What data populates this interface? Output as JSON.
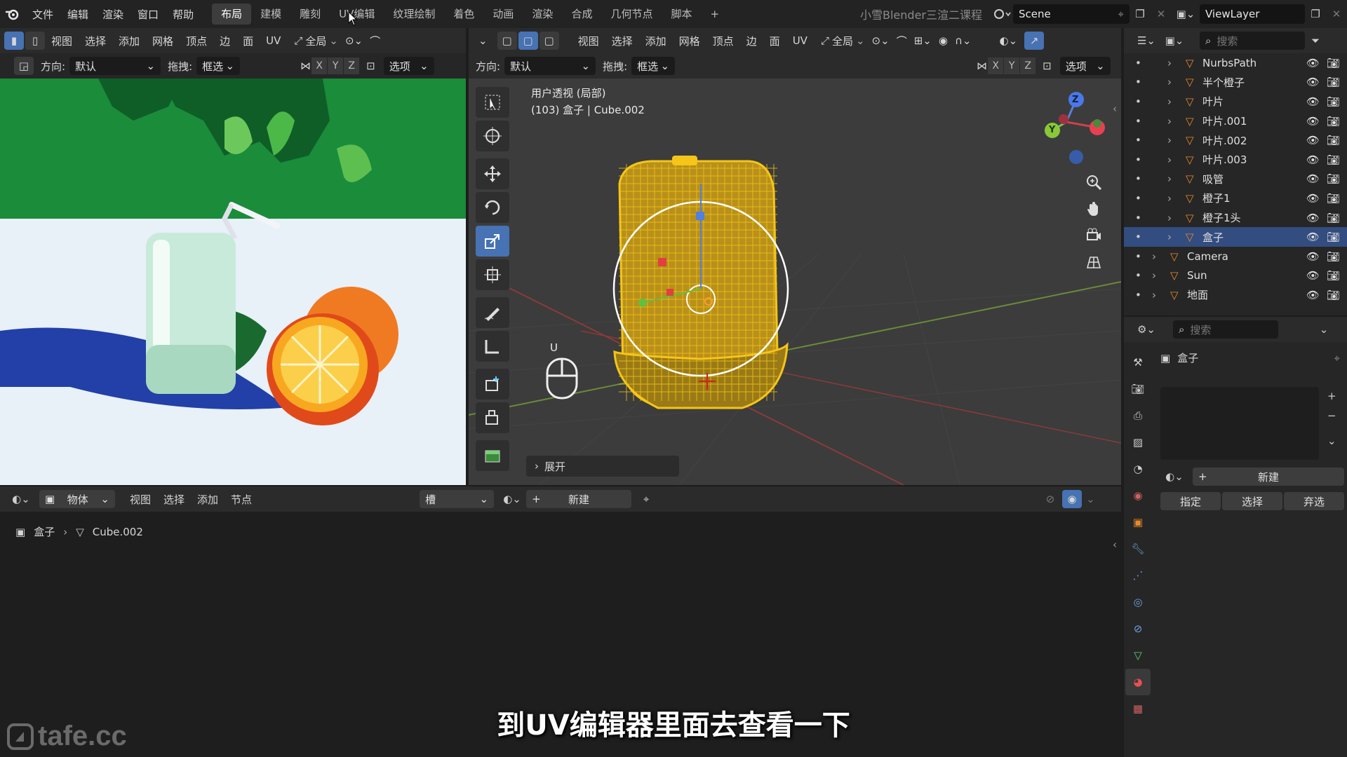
{
  "topbar": {
    "menus": [
      "文件",
      "编辑",
      "渲染",
      "窗口",
      "帮助"
    ],
    "workspaces": [
      "布局",
      "建模",
      "雕刻",
      "UV编辑",
      "纹理绘制",
      "着色",
      "动画",
      "渲染",
      "合成",
      "几何节点",
      "脚本"
    ],
    "active_workspace": "布局",
    "add_tab": "+",
    "course_title": "小雪Blender三渲二课程",
    "scene": "Scene",
    "view_layer": "ViewLayer"
  },
  "left_view": {
    "menus": [
      "视图",
      "选择",
      "添加",
      "网格",
      "顶点",
      "边",
      "面",
      "UV"
    ],
    "transform": "全局",
    "orientation_label": "方向:",
    "orientation_value": "默认",
    "drag_label": "拖拽:",
    "drag_value": "框选",
    "axes": [
      "X",
      "Y",
      "Z"
    ],
    "options": "选项"
  },
  "main_view": {
    "menus": [
      "视图",
      "选择",
      "添加",
      "网格",
      "顶点",
      "边",
      "面",
      "UV"
    ],
    "transform": "全局",
    "orientation_label": "方向:",
    "orientation_value": "默认",
    "drag_label": "拖拽:",
    "drag_value": "框选",
    "axes": [
      "X",
      "Y",
      "Z"
    ],
    "options": "选项",
    "info_line1": "用户透视 (局部)",
    "info_line2": "(103) 盒子 | Cube.002",
    "key_hint": "U",
    "expand_panel": "展开",
    "gizmo": {
      "z": "Z",
      "y": "Y"
    }
  },
  "node_editor": {
    "mode": "物体",
    "menus": [
      "视图",
      "选择",
      "添加",
      "节点"
    ],
    "slot": "槽",
    "new_button": "新建",
    "breadcrumb_object": "盒子",
    "breadcrumb_mesh": "Cube.002"
  },
  "outliner": {
    "search_placeholder": "搜索",
    "items": [
      {
        "name": "NurbsPath",
        "selected": false
      },
      {
        "name": "半个橙子",
        "selected": false
      },
      {
        "name": "叶片",
        "selected": false
      },
      {
        "name": "叶片.001",
        "selected": false
      },
      {
        "name": "叶片.002",
        "selected": false
      },
      {
        "name": "叶片.003",
        "selected": false
      },
      {
        "name": "吸管",
        "selected": false
      },
      {
        "name": "橙子1",
        "selected": false
      },
      {
        "name": "橙子1头",
        "selected": false
      },
      {
        "name": "盒子",
        "selected": true
      },
      {
        "name": "Camera",
        "selected": false
      },
      {
        "name": "Sun",
        "selected": false
      },
      {
        "name": "地面",
        "selected": false
      }
    ]
  },
  "properties": {
    "search_placeholder": "搜索",
    "object_name": "盒子",
    "new_button": "新建",
    "assign": "指定",
    "select": "选择",
    "deselect": "弃选"
  },
  "subtitle": "到UV编辑器里面去查看一下",
  "watermark": "tafe.cc",
  "colors": {
    "accent": "#4772b3",
    "selection": "#334d80",
    "mesh_wire": "#f5c518",
    "object_orange": "#e8892b"
  }
}
